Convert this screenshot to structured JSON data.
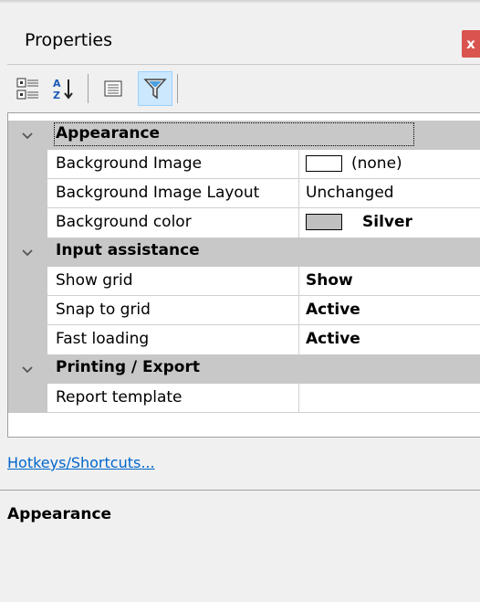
{
  "window": {
    "title": "Properties",
    "close_label": "x"
  },
  "toolbar": {
    "buttons": [
      {
        "icon": "categorized-icon",
        "active": false
      },
      {
        "icon": "alphabetical-sort-icon",
        "active": false
      },
      {
        "icon": "property-pages-icon",
        "active": false
      },
      {
        "icon": "filter-icon",
        "active": true
      }
    ]
  },
  "grid": {
    "categories": [
      {
        "label": "Appearance",
        "properties": [
          {
            "name": "Background Image",
            "value": "(none)",
            "swatch": "#ffffff",
            "bold": false
          },
          {
            "name": "Background Image Layout",
            "value": "Unchanged",
            "bold": false
          },
          {
            "name": "Background color",
            "value": "Silver",
            "swatch": "#c0c0c0",
            "bold": true
          }
        ]
      },
      {
        "label": "Input assistance",
        "properties": [
          {
            "name": "Show grid",
            "value": "Show",
            "bold": true
          },
          {
            "name": "Snap to grid",
            "value": "Active",
            "bold": true
          },
          {
            "name": "Fast loading",
            "value": "Active",
            "bold": true
          }
        ]
      },
      {
        "label": "Printing / Export",
        "properties": [
          {
            "name": "Report template",
            "value": "",
            "bold": false
          }
        ]
      }
    ]
  },
  "link": {
    "label": "Hotkeys/Shortcuts..."
  },
  "description": {
    "title": "Appearance"
  },
  "colors": {
    "category_bg": "#c8c8c8",
    "close_bg": "#d9534f",
    "link": "#0066cc",
    "active_button_bg": "#cce8ff"
  }
}
